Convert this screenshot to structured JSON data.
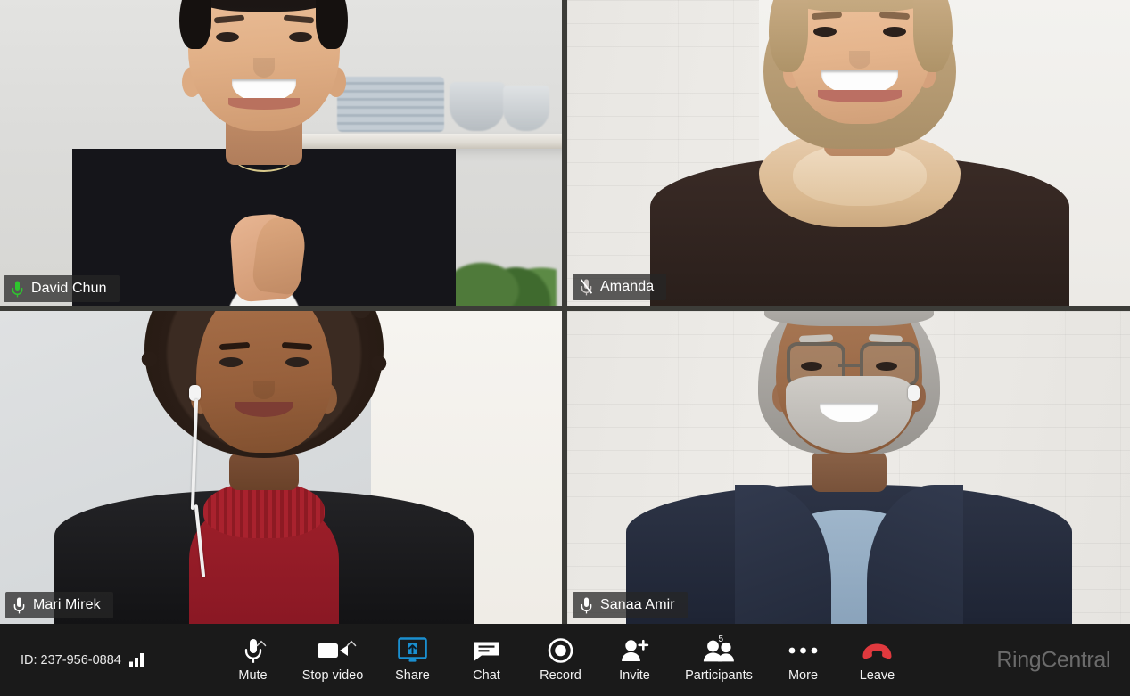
{
  "app": {
    "brand": "RingCentral",
    "accent_green": "#2ec62e",
    "toolbar_bg": "#1a1a1a",
    "grid_gap_color": "#3c3c38"
  },
  "status_bar": {
    "meeting_id_label": "ID: 237-956-0884",
    "signal_icon": "signal-bars-icon",
    "signal_strength": 3
  },
  "grid": {
    "columns": 2,
    "rows": 2,
    "participants": [
      {
        "name": "David Chun",
        "mic_icon": "microphone-icon",
        "mic_state": "active",
        "mic_color": "#2ec62e",
        "active_speaker": true,
        "position": "top-left"
      },
      {
        "name": "Amanda",
        "mic_icon": "microphone-muted-icon",
        "mic_state": "muted",
        "mic_color": "#c9c4c2",
        "active_speaker": false,
        "position": "top-right"
      },
      {
        "name": "Mari Mirek",
        "mic_icon": "microphone-icon",
        "mic_state": "unmuted",
        "mic_color": "#ffffff",
        "active_speaker": false,
        "position": "bottom-left"
      },
      {
        "name": "Sanaa Amir",
        "mic_icon": "microphone-icon",
        "mic_state": "unmuted",
        "mic_color": "#ffffff",
        "active_speaker": false,
        "position": "bottom-right"
      }
    ]
  },
  "toolbar": {
    "buttons": [
      {
        "label": "Mute",
        "icon": "microphone-icon",
        "has_caret": true,
        "badge": null
      },
      {
        "label": "Stop video",
        "icon": "video-camera-icon",
        "has_caret": true,
        "badge": null
      },
      {
        "label": "Share",
        "icon": "screen-share-icon",
        "has_caret": false,
        "badge": null,
        "color": "#1a8fd0"
      },
      {
        "label": "Chat",
        "icon": "chat-bubble-icon",
        "has_caret": false,
        "badge": null
      },
      {
        "label": "Record",
        "icon": "record-circle-icon",
        "has_caret": false,
        "badge": null
      },
      {
        "label": "Invite",
        "icon": "person-plus-icon",
        "has_caret": false,
        "badge": null
      },
      {
        "label": "Participants",
        "icon": "people-icon",
        "has_caret": false,
        "badge": "5"
      },
      {
        "label": "More",
        "icon": "ellipsis-icon",
        "has_caret": false,
        "badge": null
      },
      {
        "label": "Leave",
        "icon": "phone-hangup-icon",
        "has_caret": false,
        "badge": null,
        "color": "#e0393e"
      }
    ]
  }
}
